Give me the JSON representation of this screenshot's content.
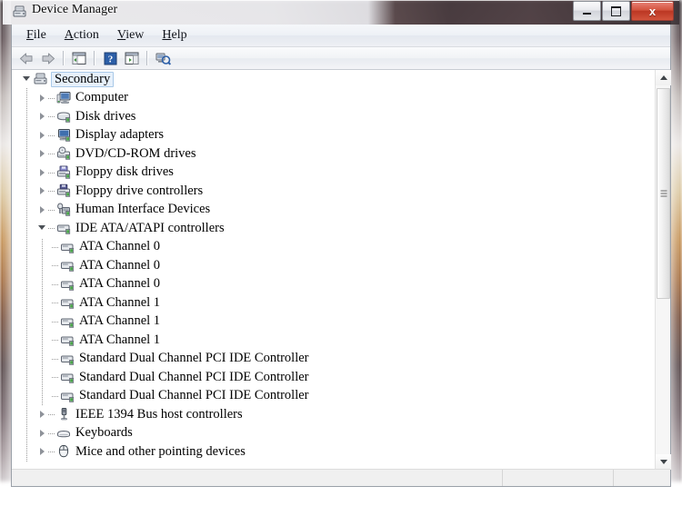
{
  "window": {
    "title": "Device Manager",
    "title_icon": "device-manager-icon",
    "controls": {
      "minimize_label": "Minimize",
      "maximize_label": "Maximize",
      "close_label": "x"
    }
  },
  "menubar": {
    "items": [
      {
        "label": "File",
        "accel": "F"
      },
      {
        "label": "Action",
        "accel": "A"
      },
      {
        "label": "View",
        "accel": "V"
      },
      {
        "label": "Help",
        "accel": "H"
      }
    ]
  },
  "toolbar": {
    "buttons": [
      {
        "name": "back-icon",
        "label": "Back"
      },
      {
        "name": "forward-icon",
        "label": "Forward"
      },
      {
        "name": "separator",
        "label": ""
      },
      {
        "name": "show-hide-console-tree-icon",
        "label": "Show/Hide Console Tree"
      },
      {
        "name": "separator",
        "label": ""
      },
      {
        "name": "help-icon",
        "label": "Help"
      },
      {
        "name": "properties-icon",
        "label": "Properties"
      },
      {
        "name": "separator",
        "label": ""
      },
      {
        "name": "scan-for-hardware-changes-icon",
        "label": "Scan for hardware changes"
      }
    ]
  },
  "tree": {
    "root": {
      "label": "Secondary",
      "icon": "computer-node-icon",
      "selected": true,
      "expanded": true
    },
    "nodes": [
      {
        "label": "Computer",
        "icon": "computer-icon",
        "level": 1,
        "state": "collapsed"
      },
      {
        "label": "Disk drives",
        "icon": "disk-drive-icon",
        "level": 1,
        "state": "collapsed"
      },
      {
        "label": "Display adapters",
        "icon": "display-adapter-icon",
        "level": 1,
        "state": "collapsed"
      },
      {
        "label": "DVD/CD-ROM drives",
        "icon": "dvd-drive-icon",
        "level": 1,
        "state": "collapsed"
      },
      {
        "label": "Floppy disk drives",
        "icon": "floppy-disk-icon",
        "level": 1,
        "state": "collapsed"
      },
      {
        "label": "Floppy drive controllers",
        "icon": "floppy-controller-icon",
        "level": 1,
        "state": "collapsed"
      },
      {
        "label": "Human Interface Devices",
        "icon": "hid-icon",
        "level": 1,
        "state": "collapsed"
      },
      {
        "label": "IDE ATA/ATAPI controllers",
        "icon": "ide-controller-icon",
        "level": 1,
        "state": "expanded"
      },
      {
        "label": "ATA Channel 0",
        "icon": "ata-channel-icon",
        "level": 2,
        "state": "leaf"
      },
      {
        "label": "ATA Channel 0",
        "icon": "ata-channel-icon",
        "level": 2,
        "state": "leaf"
      },
      {
        "label": "ATA Channel 0",
        "icon": "ata-channel-icon",
        "level": 2,
        "state": "leaf"
      },
      {
        "label": "ATA Channel 1",
        "icon": "ata-channel-icon",
        "level": 2,
        "state": "leaf"
      },
      {
        "label": "ATA Channel 1",
        "icon": "ata-channel-icon",
        "level": 2,
        "state": "leaf"
      },
      {
        "label": "ATA Channel 1",
        "icon": "ata-channel-icon",
        "level": 2,
        "state": "leaf"
      },
      {
        "label": "Standard Dual Channel PCI IDE Controller",
        "icon": "ata-channel-icon",
        "level": 2,
        "state": "leaf"
      },
      {
        "label": "Standard Dual Channel PCI IDE Controller",
        "icon": "ata-channel-icon",
        "level": 2,
        "state": "leaf"
      },
      {
        "label": "Standard Dual Channel PCI IDE Controller",
        "icon": "ata-channel-icon",
        "level": 2,
        "state": "leaf"
      },
      {
        "label": "IEEE 1394 Bus host controllers",
        "icon": "ieee1394-icon",
        "level": 1,
        "state": "collapsed"
      },
      {
        "label": "Keyboards",
        "icon": "keyboard-icon",
        "level": 1,
        "state": "collapsed"
      },
      {
        "label": "Mice and other pointing devices",
        "icon": "mouse-icon",
        "level": 1,
        "state": "collapsed"
      }
    ]
  },
  "scrollbar": {
    "up_arrow": "scroll-up-arrow",
    "down_arrow": "scroll-down-arrow",
    "thumb": "scroll-thumb"
  },
  "statusbar": {
    "panel1": "",
    "panel2": "",
    "panel3": ""
  },
  "colors": {
    "selection_fill": "#e6f0fb",
    "selection_border": "#a9c9e8",
    "close_button": "#bb3723",
    "tree_background": "#ffffff"
  }
}
